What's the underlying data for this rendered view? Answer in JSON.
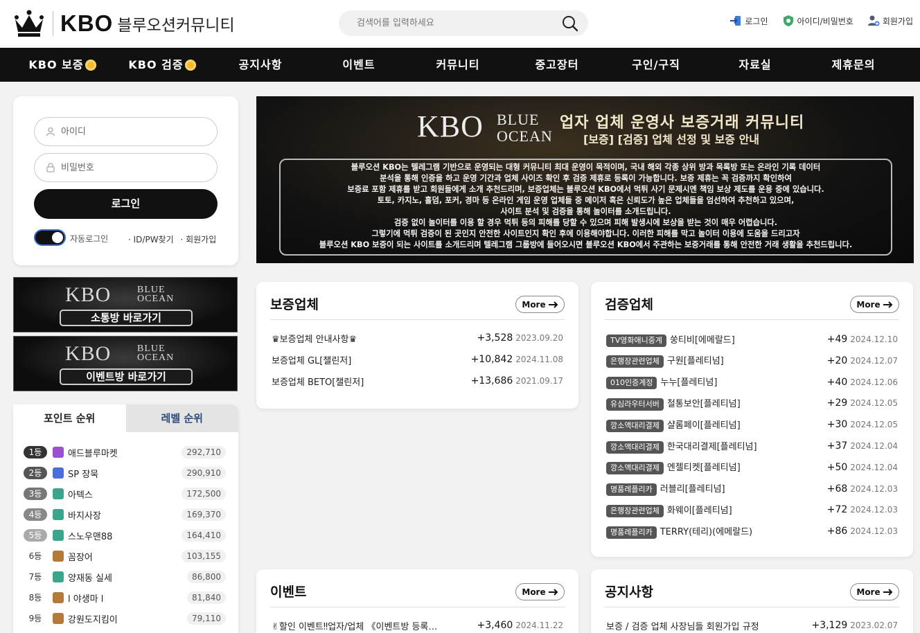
{
  "header": {
    "logo_kbo": "KBO",
    "logo_sub": "블루오션커뮤니티",
    "search_placeholder": "검색어를 입력하세요",
    "links": {
      "login": "로그인",
      "find": "아이디/비밀번호",
      "signup": "회원가입"
    }
  },
  "nav": [
    "KBO 보증",
    "KBO 검증",
    "공지사항",
    "이벤트",
    "커뮤니티",
    "중고장터",
    "구인/구직",
    "자료실",
    "제휴문의"
  ],
  "login": {
    "id_placeholder": "아이디",
    "pw_placeholder": "비밀번호",
    "button": "로그인",
    "auto_login": "자동로그인",
    "find_link": "· ID/PW찾기",
    "signup_link": "· 회원가입"
  },
  "banners": [
    {
      "kbo": "KBO",
      "blue": "BLUE",
      "ocean": "OCEAN",
      "button": "소통방 바로가기"
    },
    {
      "kbo": "KBO",
      "blue": "BLUE",
      "ocean": "OCEAN",
      "button": "이벤트방 바로가기"
    }
  ],
  "ranking": {
    "tabs": [
      "포인트 순위",
      "레벨 순위"
    ],
    "rows": [
      {
        "rank": "1등",
        "name": "애드블루마켓",
        "score": "292,710",
        "color": "#9b4fd1",
        "badge": "#333"
      },
      {
        "rank": "2등",
        "name": "SP 장묵",
        "score": "290,910",
        "color": "#4a6fd6",
        "badge": "#555"
      },
      {
        "rank": "3등",
        "name": "아텍스",
        "score": "172,500",
        "color": "#3aa58a",
        "badge": "#777"
      },
      {
        "rank": "4등",
        "name": "바지사장",
        "score": "169,370",
        "color": "#3aa58a",
        "badge": "#888"
      },
      {
        "rank": "5등",
        "name": "스노우맨88",
        "score": "164,410",
        "color": "#3aa58a",
        "badge": "#aaa"
      },
      {
        "rank": "6등",
        "name": "꼼장어",
        "score": "103,155",
        "color": "#b57a3a",
        "badge": ""
      },
      {
        "rank": "7등",
        "name": "양재동 실세",
        "score": "86,800",
        "color": "#3aa58a",
        "badge": ""
      },
      {
        "rank": "8등",
        "name": "l 야생마 l",
        "score": "81,840",
        "color": "#b57a3a",
        "badge": ""
      },
      {
        "rank": "9등",
        "name": "강원도지킴이",
        "score": "79,110",
        "color": "#b57a3a",
        "badge": ""
      }
    ]
  },
  "hero": {
    "kbo": "KBO",
    "blue": "BLUE",
    "ocean": "OCEAN",
    "title": "업자 업체 운영사 보증거래 커뮤니티",
    "subtitle": "[보증] [검증] 업체 선정 및 보증 안내",
    "lines": [
      "블루오션 KBO는 텔레그램 기반으로 운영되는 대형 커뮤니티 최대 운영이 목적이며, 국내 해외 각종 상위 방과 목록방 또는 온라인 기록 데이터",
      "분석을 통해 인증을 하고 운영 기간과 업체 사이즈 확인 후 검증 제휴로 등록이 가능합니다. 보증 제휴는 꼭 검증까지 확인하여",
      "보증료 포함 제휴를 받고 회원들에게 소개 추천드리며, 보증업체는 블루오션 KBO에서 먹튀 사기 문제시엔 책임 보상 제도를 운용 중에 있습니다.",
      "토토, 카지노, 홀덤, 포커, 경마 등 온라인 게임 운영 업체들 중 메이저 혹은 신뢰도가 높은 업체들을 엄선하여 추천하고 있으며,",
      "사이트 분석 및 검증을 통해 놀이터를 소개드립니다.",
      "검증 없이 놀이터를 이용 할 경우 먹튀 등의 피해를 당할 수 있으며 피해 발생시에 보상을 받는 것이 매우 어렵습니다.",
      "그렇기에 먹튀 검증이 된 곳인지 안전한 사이트인지 확인 후에 이용해야합니다. 이러한 피해를 막고 놀이터 이용에 도움을 드리고자",
      "블루오션 KBO 보증이 되는 사이트를 소개드리며 텔레그램 그룹방에 들어오시면 블루오션 KBO에서 주관하는 보증거래를 통해 안전한 거래 생활을 추천드립니다."
    ]
  },
  "cards": {
    "guarantee": {
      "title": "보증업체",
      "more": "More",
      "rows": [
        {
          "title": "♛보증업체 안내사항♛",
          "count": "+3,528",
          "date": "2023.09.20"
        },
        {
          "title": "보증업체 GL[챌린저]",
          "count": "+10,842",
          "date": "2024.11.08"
        },
        {
          "title": "보증업체 BETO[챌린저]",
          "count": "+13,686",
          "date": "2021.09.17"
        }
      ]
    },
    "verified": {
      "title": "검증업체",
      "more": "More",
      "rows": [
        {
          "tag": "TV영화애니중계",
          "title": "쑹티비[에메랄드]",
          "count": "+49",
          "date": "2024.12.10"
        },
        {
          "tag": "은행장관련업체",
          "title": "구원[플레티넘]",
          "count": "+20",
          "date": "2024.12.07"
        },
        {
          "tag": "010인증계정",
          "title": "누누[플레티넘]",
          "count": "+40",
          "date": "2024.12.06"
        },
        {
          "tag": "유심라우터서버",
          "title": "철통보안[플레티넘]",
          "count": "+29",
          "date": "2024.12.05"
        },
        {
          "tag": "깡소액대리결제",
          "title": "샬롬페이[플레티넘]",
          "count": "+30",
          "date": "2024.12.05"
        },
        {
          "tag": "깡소액대리결제",
          "title": "한국대리결제[플레티넘]",
          "count": "+37",
          "date": "2024.12.04"
        },
        {
          "tag": "깡소액대리결제",
          "title": "엔젤티켓[플레티넘]",
          "count": "+50",
          "date": "2024.12.04"
        },
        {
          "tag": "명품레플리카",
          "title": "러블리[플레티넘]",
          "count": "+68",
          "date": "2024.12.03"
        },
        {
          "tag": "은행장관련업체",
          "title": "화웨이[플레티넘]",
          "count": "+72",
          "date": "2024.12.03"
        },
        {
          "tag": "명품레플리카",
          "title": "TERRY(테리)(에메랄드)",
          "count": "+86",
          "date": "2024.12.03"
        }
      ]
    },
    "event": {
      "title": "이벤트",
      "more": "More",
      "rows": [
        {
          "title": "✌할인 이벤트‼업자/업체 《이벤트방 등록…",
          "count": "+3,460",
          "date": "2024.11.22"
        }
      ]
    },
    "notice": {
      "title": "공지사항",
      "more": "More",
      "rows": [
        {
          "title": "보증 / 검증 업체 사장님들 회원가입 규정",
          "count": "+3,129",
          "date": "2023.02.07"
        }
      ]
    }
  }
}
